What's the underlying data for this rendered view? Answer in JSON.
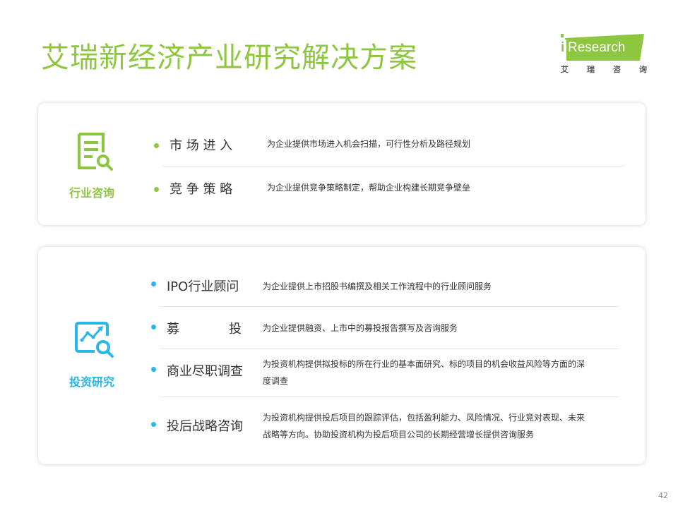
{
  "title": "艾瑞新经济产业研究解决方案",
  "logo": {
    "brand_i": "i",
    "brand_text": "Research",
    "cn_chars": [
      "艾",
      "瑞",
      "咨",
      "询"
    ],
    "accent": "#8dc63f"
  },
  "sections": [
    {
      "label": "行业咨询",
      "icon": "document-search-icon",
      "color": "#8dc63f",
      "items": [
        {
          "name": "市 场 进 入",
          "desc": "为企业提供市场进入机会扫描，可行性分析及路径规划"
        },
        {
          "name": "竞 争 策 略",
          "desc": "为企业提供竞争策略制定，帮助企业构建长期竞争壁垒"
        }
      ]
    },
    {
      "label": "投资研究",
      "icon": "investment-analysis-icon",
      "color": "#29b6e9",
      "items": [
        {
          "name": "IPO行业顾问",
          "desc": "为企业提供上市招股书编撰及相关工作流程中的行业顾问服务"
        },
        {
          "name_left": "募",
          "name_right": "投",
          "desc": "为企业提供融资、上市中的募投报告撰写及咨询服务"
        },
        {
          "name": "商业尽职调查",
          "desc_line1": "为投资机构提供拟投标的所在行业的基本面研究、标的项目的机会收益风险等方面的深",
          "desc_line2": "度调查"
        },
        {
          "name": "投后战略咨询",
          "desc_line1": "为投资机构提供投后项目的跟踪评估，包括盈利能力、风险情况、行业竞对表现、未来",
          "desc_line2": "战略等方向。协助投资机构为投后项目公司的长期经营增长提供咨询服务"
        }
      ]
    }
  ],
  "page_number": "42"
}
